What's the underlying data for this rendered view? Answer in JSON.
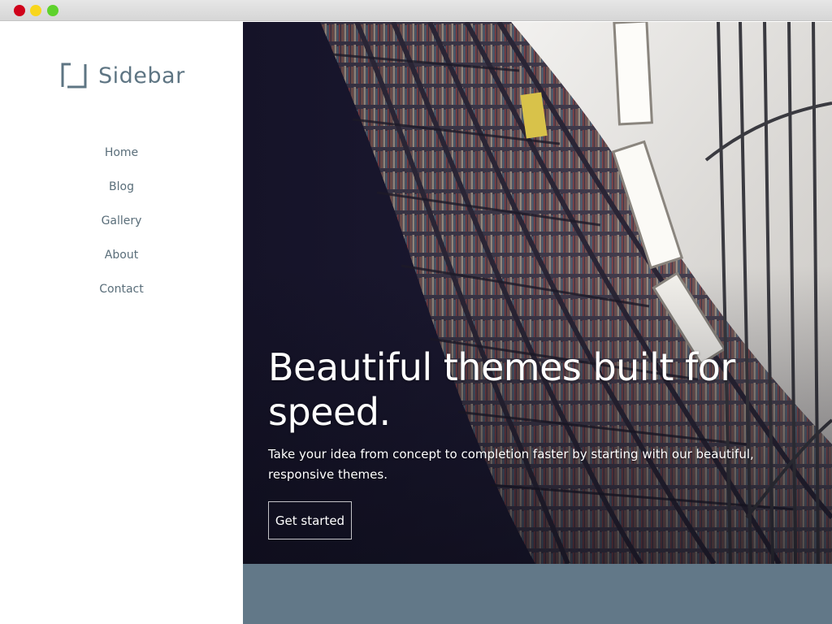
{
  "window": {
    "controls": [
      "close",
      "minimize",
      "maximize"
    ],
    "colors": {
      "close": "#d0021b",
      "minimize": "#f8d61c",
      "maximize": "#5ed22c"
    }
  },
  "brand": {
    "name": "Sidebar",
    "icon": "bracket-square-logo-icon",
    "color": "#5e7583"
  },
  "nav": {
    "items": [
      {
        "label": "Home"
      },
      {
        "label": "Blog"
      },
      {
        "label": "Gallery"
      },
      {
        "label": "About"
      },
      {
        "label": "Contact"
      }
    ]
  },
  "hero": {
    "title": "Beautiful themes built for speed.",
    "subtitle": "Take your idea from concept to completion faster by starting with our beautiful, responsive themes.",
    "cta_label": "Get started",
    "image": "library-bookshelves-photo"
  },
  "colors": {
    "band": "#627888",
    "nav_text": "#5a6e7a"
  }
}
